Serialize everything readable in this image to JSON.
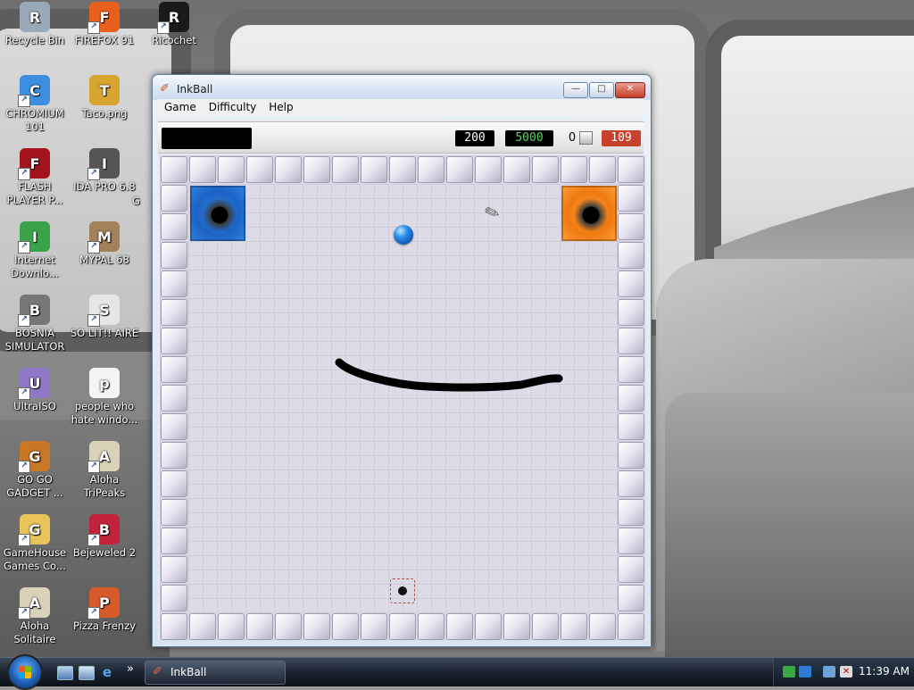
{
  "desktop": {
    "icons": [
      {
        "label": "Recycle Bin",
        "icon": "recycle-bin-icon",
        "color": "#9aa9b8"
      },
      {
        "label": "FIREFOX 91",
        "icon": "firefox-icon",
        "color": "#e8601c"
      },
      {
        "label": "Ricochet",
        "icon": "ricochet-icon",
        "color": "#1a1a1a"
      },
      {
        "label": "CHROMIUM 101",
        "icon": "chromium-icon",
        "color": "#3d8ee0"
      },
      {
        "label": "Taco.png",
        "icon": "taco-image-icon",
        "color": "#d8a531"
      },
      {
        "label": "FLASH PLAYER P...",
        "icon": "flash-player-icon",
        "color": "#a3141c"
      },
      {
        "label": "IDA PRO 6.8",
        "icon": "ida-pro-icon",
        "color": "#555555"
      },
      {
        "label": "Internet Downlo...",
        "icon": "internet-download-icon",
        "color": "#3aa34a"
      },
      {
        "label": "MYPAL 68",
        "icon": "mypal-icon",
        "color": "#a0815a"
      },
      {
        "label": "BOSNIA SIMULATOR",
        "icon": "bosnia-simulator-icon",
        "color": "#777777"
      },
      {
        "label": "SO LIT!! AIRE",
        "icon": "so-lit-aire-icon",
        "color": "#e6e6e6"
      },
      {
        "label": "UltraISO",
        "icon": "ultraiso-icon",
        "color": "#8f78c8"
      },
      {
        "label": "people who hate windo...",
        "icon": "text-document-icon",
        "color": "#f4f4f4"
      },
      {
        "label": "GO GO GADGET ...",
        "icon": "briefcase-icon",
        "color": "#c87726"
      },
      {
        "label": "Aloha TriPeaks",
        "icon": "aloha-tripeaks-icon",
        "color": "#d8d2b8"
      },
      {
        "label": "GameHouse Games Co...",
        "icon": "folder-icon",
        "color": "#e8c35a"
      },
      {
        "label": "Bejeweled 2",
        "icon": "bejeweled-icon",
        "color": "#c2223a"
      },
      {
        "label": "Aloha Solitaire",
        "icon": "aloha-solitaire-icon",
        "color": "#d8d2b8"
      },
      {
        "label": "Pizza Frenzy",
        "icon": "pizza-icon",
        "color": "#d65a2a"
      }
    ],
    "partial_label": "G"
  },
  "window": {
    "title": "InkBall",
    "menu": [
      "Game",
      "Difficulty",
      "Help"
    ],
    "status": {
      "level_score": "200",
      "target_score": "5000",
      "ball_count": "0",
      "time_left": "109"
    },
    "colors": {
      "blue_hole": "#1d63c7",
      "orange_hole": "#ef7a12",
      "ball": "#2e8fe8",
      "ink": "#000000",
      "time_badge": "#c8412c",
      "target_text": "#5ad65a"
    }
  },
  "taskbar": {
    "task_label": "InkBall",
    "clock": "11:39 AM",
    "quick_launch": [
      "show-desktop-icon",
      "switch-windows-icon",
      "internet-explorer-icon"
    ],
    "overflow": "»"
  }
}
